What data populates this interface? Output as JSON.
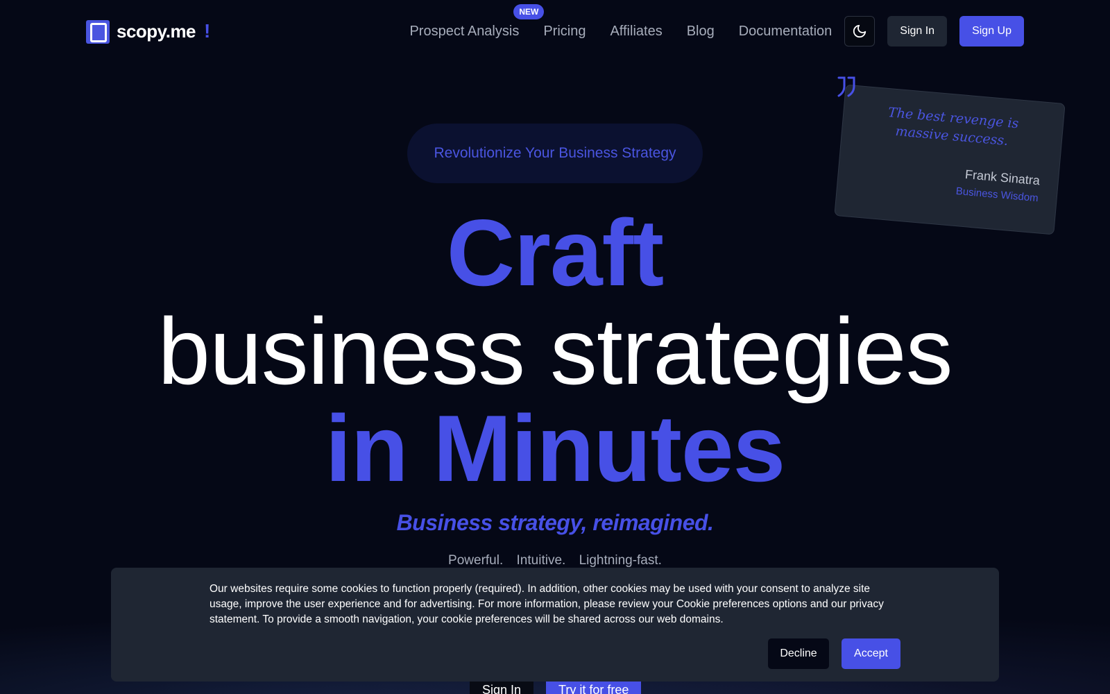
{
  "brand": {
    "name": "scopy.me",
    "suffix": "!",
    "accent": "#4750e6"
  },
  "nav": {
    "items": [
      {
        "label": "Prospect Analysis",
        "badge": "NEW"
      },
      {
        "label": "Pricing"
      },
      {
        "label": "Affiliates"
      },
      {
        "label": "Blog"
      },
      {
        "label": "Documentation"
      }
    ],
    "theme_toggle_icon": "moon-icon",
    "sign_in": "Sign In",
    "sign_up": "Sign Up"
  },
  "quote": {
    "text": "The best revenge is massive success.",
    "author": "Frank Sinatra",
    "source": "Business Wisdom",
    "icon": "quote-icon"
  },
  "hero": {
    "pill": "Revolutionize Your Business Strategy",
    "line1": "Craft",
    "line2": "business strategies",
    "line3": "in Minutes",
    "tagline": "Business strategy, reimagined.",
    "subtags": [
      "Powerful.",
      "Intuitive.",
      "Lightning-fast."
    ],
    "sign_in": "Sign In",
    "try_free": "Try it for free"
  },
  "cookie": {
    "text": "Our websites require some cookies to function properly (required). In addition, other cookies may be used with your consent to analyze site usage, improve the user experience and for advertising. For more information, please review your Cookie preferences options and our privacy statement. To provide a smooth navigation, your cookie preferences will be shared across our web domains.",
    "decline": "Decline",
    "accept": "Accept"
  }
}
